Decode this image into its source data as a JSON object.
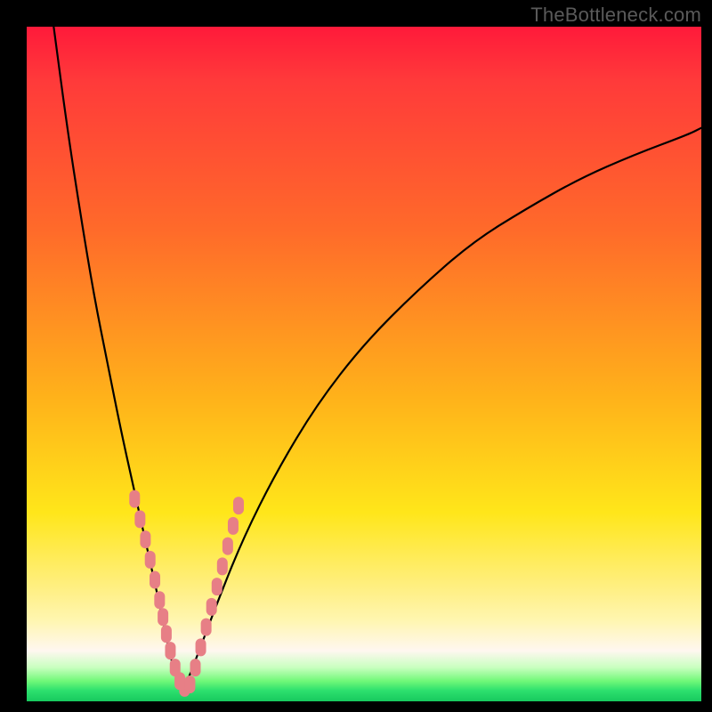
{
  "watermark": "TheBottleneck.com",
  "chart_data": {
    "type": "line",
    "title": "",
    "xlabel": "",
    "ylabel": "",
    "xlim": [
      0,
      100
    ],
    "ylim": [
      0,
      100
    ],
    "grid": false,
    "legend": false,
    "notes": "Bottleneck curve: V-shape with minimum near x≈23. Background gradient red→green indicates bottleneck severity (red=high, green=low). Pink rounded markers cluster along both arms of the V in the lower yellow/green band.",
    "series": [
      {
        "name": "left-arm",
        "x": [
          4,
          6,
          8,
          10,
          12,
          14,
          16,
          18,
          20,
          21,
          22,
          23
        ],
        "y": [
          100,
          85,
          72,
          60,
          50,
          40,
          31,
          22,
          13,
          8,
          4,
          1
        ]
      },
      {
        "name": "right-arm",
        "x": [
          23,
          25,
          28,
          32,
          37,
          43,
          50,
          58,
          66,
          74,
          82,
          90,
          98,
          100
        ],
        "y": [
          1,
          6,
          14,
          24,
          34,
          44,
          53,
          61,
          68,
          73,
          77.5,
          81,
          84,
          85
        ]
      }
    ],
    "markers": [
      {
        "x": 16.0,
        "y": 30
      },
      {
        "x": 16.8,
        "y": 27
      },
      {
        "x": 17.6,
        "y": 24
      },
      {
        "x": 18.3,
        "y": 21
      },
      {
        "x": 19.0,
        "y": 18
      },
      {
        "x": 19.7,
        "y": 15
      },
      {
        "x": 20.2,
        "y": 12.5
      },
      {
        "x": 20.7,
        "y": 10
      },
      {
        "x": 21.3,
        "y": 7.5
      },
      {
        "x": 22.0,
        "y": 5
      },
      {
        "x": 22.7,
        "y": 3
      },
      {
        "x": 23.4,
        "y": 2
      },
      {
        "x": 24.2,
        "y": 2.5
      },
      {
        "x": 25.0,
        "y": 5
      },
      {
        "x": 25.8,
        "y": 8
      },
      {
        "x": 26.6,
        "y": 11
      },
      {
        "x": 27.4,
        "y": 14
      },
      {
        "x": 28.2,
        "y": 17
      },
      {
        "x": 29.0,
        "y": 20
      },
      {
        "x": 29.8,
        "y": 23
      },
      {
        "x": 30.6,
        "y": 26
      },
      {
        "x": 31.4,
        "y": 29
      }
    ],
    "gradient_stops": [
      {
        "pct": 0,
        "color": "#ff1a3a"
      },
      {
        "pct": 30,
        "color": "#ff6a2a"
      },
      {
        "pct": 72,
        "color": "#ffe61a"
      },
      {
        "pct": 92,
        "color": "#fff7f0"
      },
      {
        "pct": 100,
        "color": "#17c95e"
      }
    ]
  }
}
